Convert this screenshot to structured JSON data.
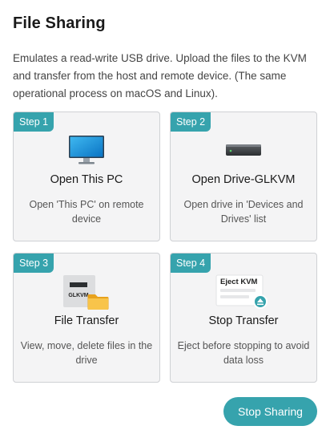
{
  "header": {
    "title": "File Sharing",
    "description": "Emulates a read-write USB drive. Upload the files to the KVM and transfer from the host and remote device. (The same operational process on macOS and Linux)."
  },
  "steps": [
    {
      "badge": "Step 1",
      "title": "Open This PC",
      "desc": "Open 'This PC' on remote device",
      "icon": "monitor-icon"
    },
    {
      "badge": "Step 2",
      "title": "Open Drive-GLKVM",
      "desc": "Open drive in 'Devices and Drives' list",
      "icon": "usb-drive-icon"
    },
    {
      "badge": "Step 3",
      "title": "File Transfer",
      "desc": "View, move, delete files in the drive",
      "icon": "drive-folder-icon",
      "icon_text": "GLKVM"
    },
    {
      "badge": "Step 4",
      "title": "Stop Transfer",
      "desc": "Eject before stopping to avoid data loss",
      "icon": "eject-icon",
      "icon_text": "Eject KVM"
    }
  ],
  "actions": {
    "stop_sharing": "Stop Sharing"
  },
  "colors": {
    "accent": "#36a3ad",
    "card_bg": "#f4f4f5",
    "card_border": "#cfd1d4"
  }
}
